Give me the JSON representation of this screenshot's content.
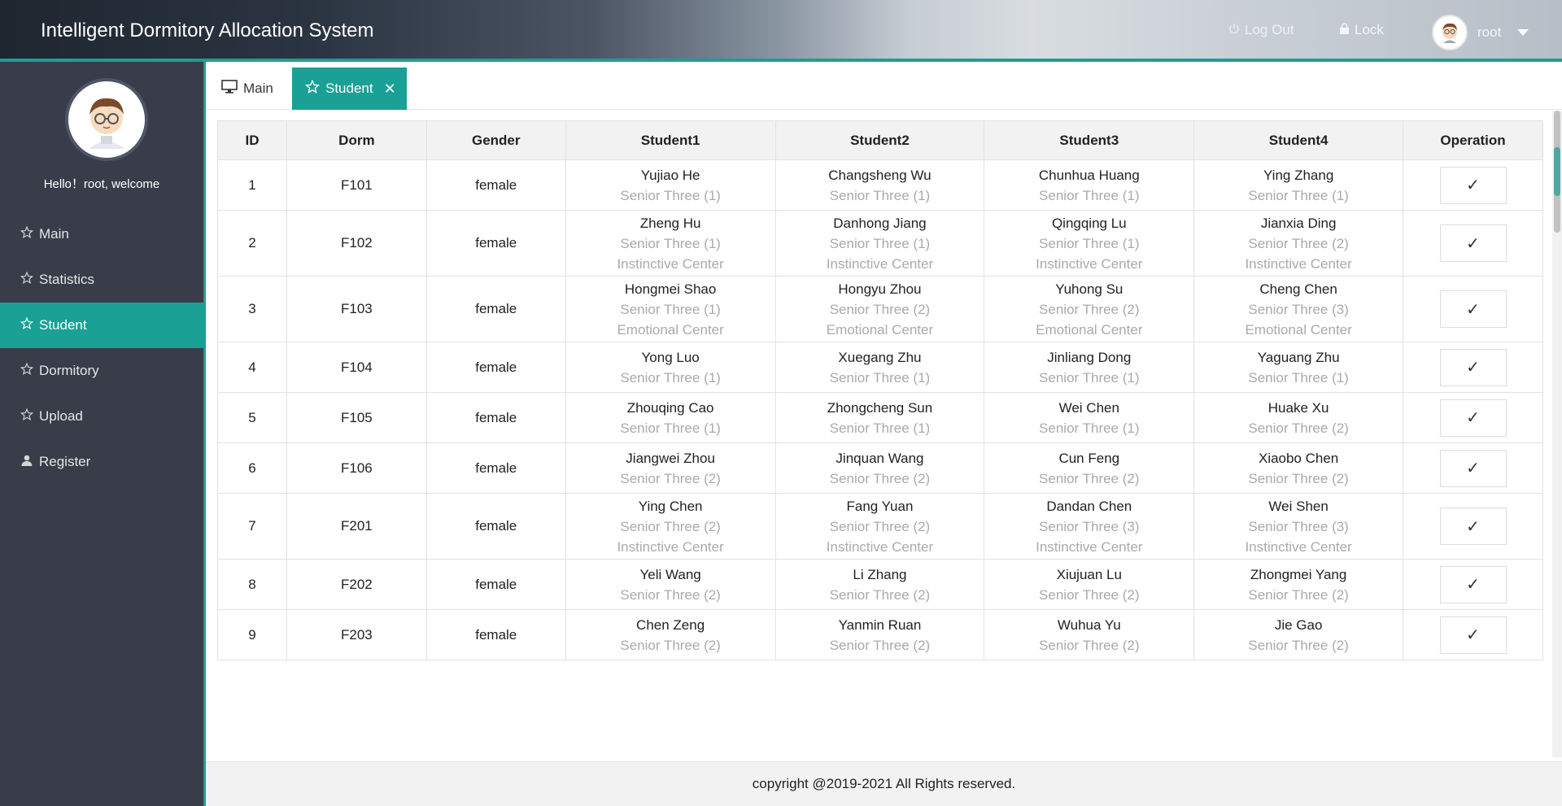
{
  "header": {
    "title": "Intelligent Dormitory Allocation System",
    "logout_label": "Log Out",
    "lock_label": "Lock",
    "username": "root"
  },
  "sidebar": {
    "welcome": "Hello！root, welcome",
    "items": [
      {
        "label": "Main",
        "icon": "star-icon"
      },
      {
        "label": "Statistics",
        "icon": "star-icon"
      },
      {
        "label": "Student",
        "icon": "star-icon",
        "active": true
      },
      {
        "label": "Dormitory",
        "icon": "star-icon"
      },
      {
        "label": "Upload",
        "icon": "star-icon"
      },
      {
        "label": "Register",
        "icon": "user-icon"
      }
    ]
  },
  "tabs": [
    {
      "label": "Main",
      "icon": "monitor-icon"
    },
    {
      "label": "Student",
      "icon": "star-icon",
      "active": true
    }
  ],
  "table": {
    "columns": [
      "ID",
      "Dorm",
      "Gender",
      "Student1",
      "Student2",
      "Student3",
      "Student4",
      "Operation"
    ],
    "rows": [
      {
        "id": "1",
        "dorm": "F101",
        "gender": "female",
        "students": [
          {
            "name": "Yujiao He",
            "cls": "Senior Three (1)",
            "center": ""
          },
          {
            "name": "Changsheng Wu",
            "cls": "Senior Three (1)",
            "center": ""
          },
          {
            "name": "Chunhua Huang",
            "cls": "Senior Three (1)",
            "center": ""
          },
          {
            "name": "Ying Zhang",
            "cls": "Senior Three (1)",
            "center": ""
          }
        ]
      },
      {
        "id": "2",
        "dorm": "F102",
        "gender": "female",
        "students": [
          {
            "name": "Zheng Hu",
            "cls": "Senior Three (1)",
            "center": "Instinctive Center"
          },
          {
            "name": "Danhong Jiang",
            "cls": "Senior Three (1)",
            "center": "Instinctive Center"
          },
          {
            "name": "Qingqing Lu",
            "cls": "Senior Three (1)",
            "center": "Instinctive Center"
          },
          {
            "name": "Jianxia Ding",
            "cls": "Senior Three (2)",
            "center": "Instinctive Center"
          }
        ]
      },
      {
        "id": "3",
        "dorm": "F103",
        "gender": "female",
        "students": [
          {
            "name": "Hongmei Shao",
            "cls": "Senior Three (1)",
            "center": "Emotional Center"
          },
          {
            "name": "Hongyu Zhou",
            "cls": "Senior Three (2)",
            "center": "Emotional Center"
          },
          {
            "name": "Yuhong Su",
            "cls": "Senior Three (2)",
            "center": "Emotional Center"
          },
          {
            "name": "Cheng Chen",
            "cls": "Senior Three (3)",
            "center": "Emotional Center"
          }
        ]
      },
      {
        "id": "4",
        "dorm": "F104",
        "gender": "female",
        "students": [
          {
            "name": "Yong Luo",
            "cls": "Senior Three (1)",
            "center": ""
          },
          {
            "name": "Xuegang Zhu",
            "cls": "Senior Three (1)",
            "center": ""
          },
          {
            "name": "Jinliang Dong",
            "cls": "Senior Three (1)",
            "center": ""
          },
          {
            "name": "Yaguang Zhu",
            "cls": "Senior Three (1)",
            "center": ""
          }
        ]
      },
      {
        "id": "5",
        "dorm": "F105",
        "gender": "female",
        "students": [
          {
            "name": "Zhouqing Cao",
            "cls": "Senior Three (1)",
            "center": ""
          },
          {
            "name": "Zhongcheng Sun",
            "cls": "Senior Three (1)",
            "center": ""
          },
          {
            "name": "Wei Chen",
            "cls": "Senior Three (1)",
            "center": ""
          },
          {
            "name": "Huake Xu",
            "cls": "Senior Three (2)",
            "center": ""
          }
        ]
      },
      {
        "id": "6",
        "dorm": "F106",
        "gender": "female",
        "students": [
          {
            "name": "Jiangwei Zhou",
            "cls": "Senior Three (2)",
            "center": ""
          },
          {
            "name": "Jinquan Wang",
            "cls": "Senior Three (2)",
            "center": ""
          },
          {
            "name": "Cun Feng",
            "cls": "Senior Three (2)",
            "center": ""
          },
          {
            "name": "Xiaobo Chen",
            "cls": "Senior Three (2)",
            "center": ""
          }
        ]
      },
      {
        "id": "7",
        "dorm": "F201",
        "gender": "female",
        "students": [
          {
            "name": "Ying Chen",
            "cls": "Senior Three (2)",
            "center": "Instinctive Center"
          },
          {
            "name": "Fang Yuan",
            "cls": "Senior Three (2)",
            "center": "Instinctive Center"
          },
          {
            "name": "Dandan Chen",
            "cls": "Senior Three (3)",
            "center": "Instinctive Center"
          },
          {
            "name": "Wei Shen",
            "cls": "Senior Three (3)",
            "center": "Instinctive Center"
          }
        ]
      },
      {
        "id": "8",
        "dorm": "F202",
        "gender": "female",
        "students": [
          {
            "name": "Yeli Wang",
            "cls": "Senior Three (2)",
            "center": ""
          },
          {
            "name": "Li Zhang",
            "cls": "Senior Three (2)",
            "center": ""
          },
          {
            "name": "Xiujuan Lu",
            "cls": "Senior Three (2)",
            "center": ""
          },
          {
            "name": "Zhongmei Yang",
            "cls": "Senior Three (2)",
            "center": ""
          }
        ]
      },
      {
        "id": "9",
        "dorm": "F203",
        "gender": "female",
        "students": [
          {
            "name": "Chen Zeng",
            "cls": "Senior Three (2)",
            "center": ""
          },
          {
            "name": "Yanmin Ruan",
            "cls": "Senior Three (2)",
            "center": ""
          },
          {
            "name": "Wuhua Yu",
            "cls": "Senior Three (2)",
            "center": ""
          },
          {
            "name": "Jie Gao",
            "cls": "Senior Three (2)",
            "center": ""
          }
        ]
      }
    ],
    "operation_symbol": "✓"
  },
  "footer": {
    "text": "copyright @2019-2021 All Rights reserved."
  },
  "colors": {
    "accent": "#1aa094",
    "sidebar_bg": "#393d49",
    "subtext": "#aaaaaa"
  }
}
